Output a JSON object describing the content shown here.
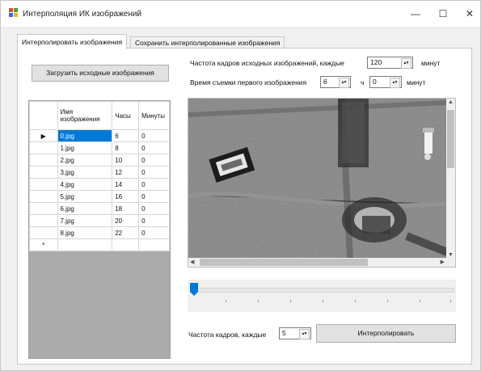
{
  "window": {
    "title": "Интерполяция ИК изображений",
    "minimize": "—",
    "maximize": "☐",
    "close": "✕"
  },
  "tabs": [
    {
      "label": "Интерполировать изображения",
      "active": true
    },
    {
      "label": "Сохранить интерполированные изображения",
      "active": false
    }
  ],
  "load_button": "Загрузить исходные изображения",
  "frame_rate_label": "Частота кадров исходных изображений, каждые",
  "frame_rate_value": "120",
  "frame_rate_unit": "минут",
  "first_time_label": "Время съемки первого изображения",
  "first_hours_value": "6",
  "hours_unit": "ч",
  "first_minutes_value": "0",
  "minutes_unit": "минут",
  "grid": {
    "headers": [
      "Имя изображения",
      "Часы",
      "Минуты"
    ],
    "rows": [
      [
        "0.jpg",
        "6",
        "0"
      ],
      [
        "1.jpg",
        "8",
        "0"
      ],
      [
        "2.jpg",
        "10",
        "0"
      ],
      [
        "3.jpg",
        "12",
        "0"
      ],
      [
        "4.jpg",
        "14",
        "0"
      ],
      [
        "5.jpg",
        "16",
        "0"
      ],
      [
        "6.jpg",
        "18",
        "0"
      ],
      [
        "7.jpg",
        "20",
        "0"
      ],
      [
        "8.jpg",
        "22",
        "0"
      ]
    ],
    "current_row_marker": "▶",
    "new_row_marker": "*"
  },
  "slider_position": 0,
  "output_rate_label": "Частота кадров, каждые",
  "output_rate_value": "5",
  "interpolate_button": "Интерполировать",
  "icons": {
    "app": "app-window-icon",
    "spin": "spin-updown-icon",
    "scroll": "scroll-arrow-icon"
  },
  "colors": {
    "selection": "#0078d7",
    "slider_thumb": "#0078d7"
  }
}
